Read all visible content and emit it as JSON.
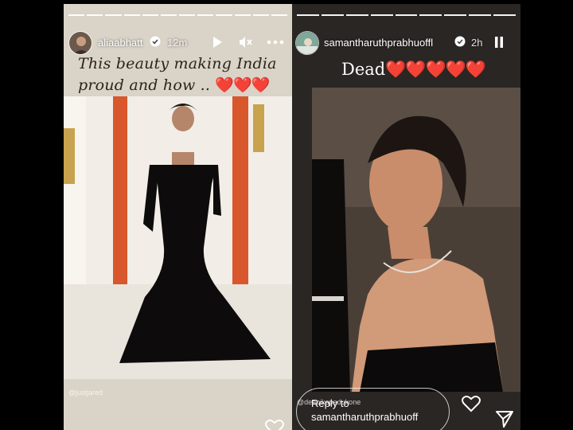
{
  "stories": [
    {
      "username": "aliaabhatt",
      "timestamp": "12m",
      "caption_text": "This beauty making India proud and how ..",
      "caption_hearts": "❤️❤️❤️❤️",
      "photo_credit": "@justjared",
      "icons": [
        "verified-badge-icon",
        "play-icon",
        "mute-icon",
        "more-options-icon",
        "heart-icon"
      ],
      "progress_segments": 12,
      "progress_done": 12
    },
    {
      "username": "samantharuthprabhuoffl",
      "timestamp": "2h",
      "caption_text": "Dead",
      "caption_hearts": "❤️❤️❤️❤️❤️",
      "photo_credit": "@deepikapadukone",
      "reply_placeholder": "Reply to samantharuthprabhuoff",
      "icons": [
        "verified-badge-icon",
        "pause-icon",
        "heart-icon",
        "send-icon"
      ],
      "progress_segments": 9,
      "progress_done": 9
    }
  ],
  "colors": {
    "heart_red": "#e0161e",
    "background": "#000000"
  }
}
